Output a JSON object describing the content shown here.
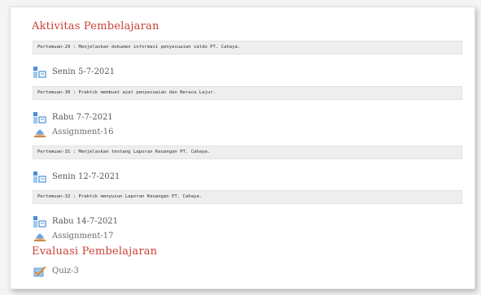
{
  "sections": {
    "aktivitas_title": "Aktivitas Pembelajaran",
    "evaluasi_title": "Evaluasi Pembelajaran"
  },
  "topics": [
    "Pertemuan-29 : Menjelaskan dokumen informasi penyesuaian saldo PT. Cahaya.",
    "Pertemuan-30 : Praktik membuat ayat penyesuaian dan Neraca Lajur.",
    "Pertemuan-31 : Menjelaskan tentang Laporan Keuangan PT. Cahaya.",
    "Pertemuan-32 : Praktik menyusun Laporan Keuangan PT. Cahaya."
  ],
  "items": [
    {
      "label": "Senin 5-7-2021",
      "icon": "attendance-icon"
    },
    {
      "label": "Rabu 7-7-2021",
      "icon": "attendance-icon"
    },
    {
      "label": "Assignment-16",
      "icon": "assignment-icon"
    },
    {
      "label": "Senin 12-7-2021",
      "icon": "attendance-icon"
    },
    {
      "label": "Rabu 14-7-2021",
      "icon": "attendance-icon"
    },
    {
      "label": "Assignment-17",
      "icon": "assignment-icon"
    },
    {
      "label": "Quiz-3",
      "icon": "quiz-icon"
    }
  ],
  "colors": {
    "section_title": "#c94034",
    "attendance_blue": "#4a8fd6",
    "attendance_light": "#9cc8f0"
  }
}
